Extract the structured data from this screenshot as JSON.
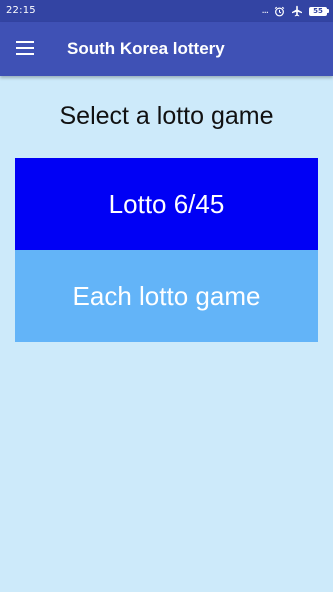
{
  "status_bar": {
    "time": "22:15",
    "overflow_dots": "...",
    "alarm_icon": "alarm-clock-icon",
    "airplane_icon": "airplane-mode-icon",
    "battery_level": "55"
  },
  "app_bar": {
    "menu_icon": "hamburger-menu-icon",
    "title": "South Korea lottery"
  },
  "main": {
    "heading": "Select a lotto game",
    "buttons": [
      {
        "label": "Lotto 6/45",
        "color": "#0000f5"
      },
      {
        "label": "Each lotto game",
        "color": "#63b4f8"
      }
    ]
  },
  "colors": {
    "status_bar": "#3344a3",
    "app_bar": "#3f51b5",
    "background": "#cdeafa"
  }
}
